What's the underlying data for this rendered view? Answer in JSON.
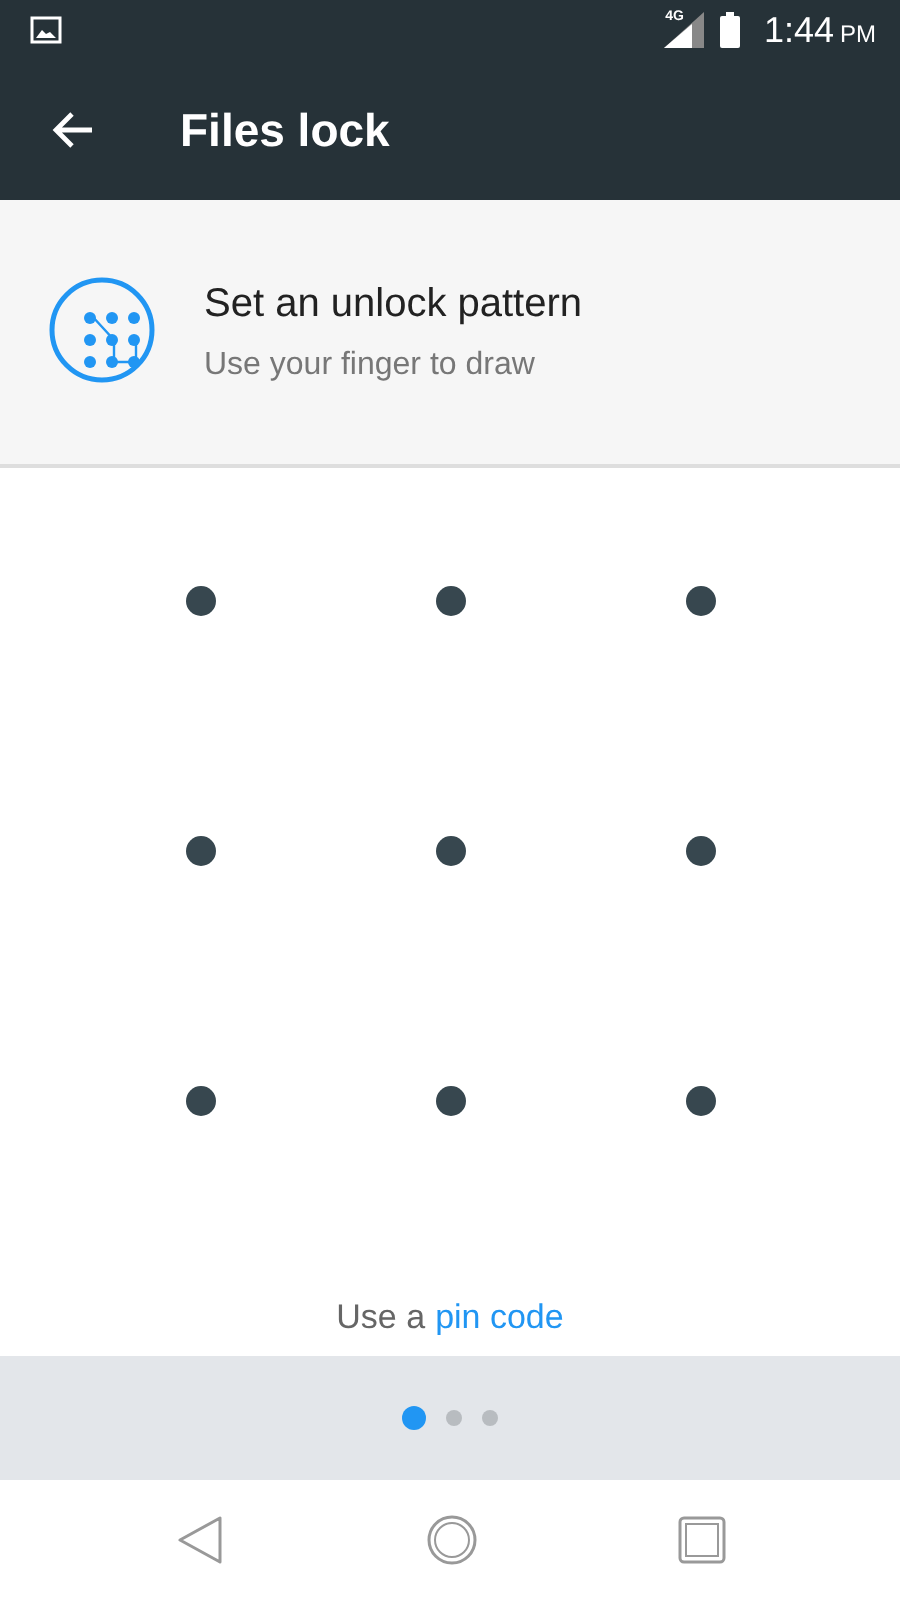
{
  "status_bar": {
    "network": "4G",
    "time": "1:44",
    "period": "PM"
  },
  "toolbar": {
    "title": "Files lock"
  },
  "header": {
    "title": "Set an unlock pattern",
    "subtitle": "Use your finger to draw"
  },
  "footer": {
    "prefix": "Use a",
    "link": "pin code"
  },
  "pages": [
    {
      "selected": true
    },
    {
      "selected": false
    },
    {
      "selected": false
    }
  ]
}
